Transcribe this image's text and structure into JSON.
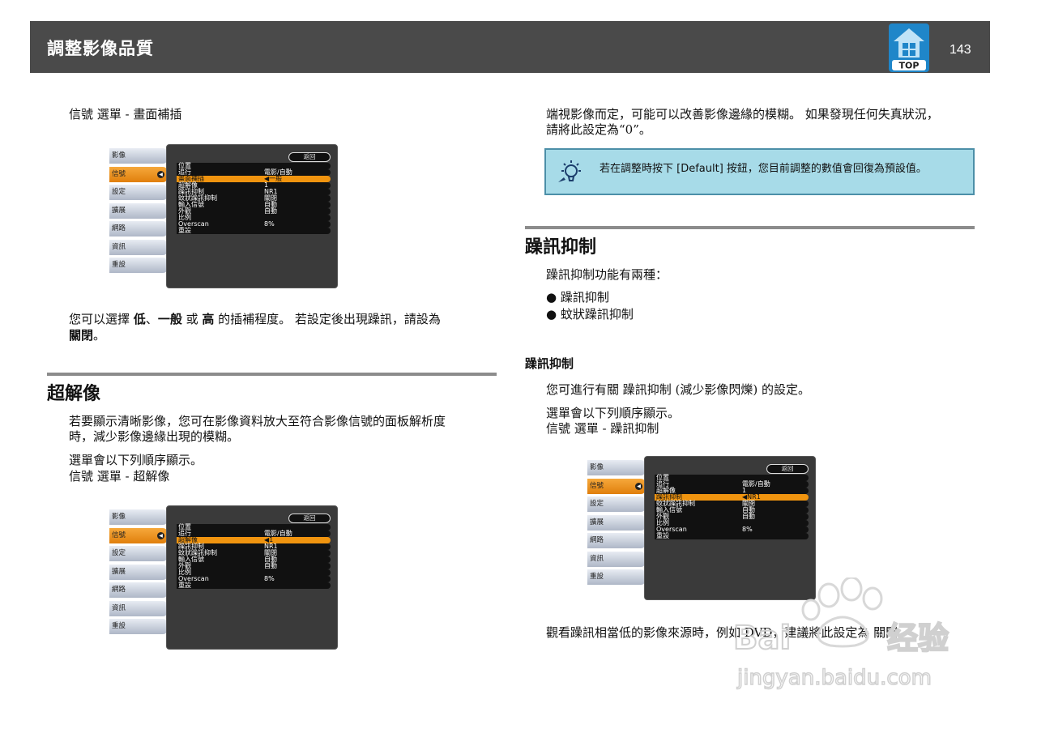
{
  "header": {
    "title": "調整影像品質",
    "page_number": "143",
    "top_label": "TOP"
  },
  "left": {
    "path1": "信號 選單 - 畫面補插",
    "para1_line1_parts": [
      "您可以選擇 ",
      "低",
      "、",
      "一般",
      " 或 ",
      "高",
      " 的插補程度。 若設定後出現躁訊，請設為"
    ],
    "para1_line2_bold": "關閉",
    "para1_line2_end": "。",
    "h_super": "超解像",
    "super_p1_l1": "若要顯示清晰影像，您可在影像資料放大至符合影像信號的面板解析度",
    "super_p1_l2": "時，減少影像邊緣出現的模糊。",
    "super_p2_l1": "選單會以下列順序顯示。",
    "super_p2_l2": "信號 選單 - 超解像"
  },
  "right": {
    "intro_l1": "端視影像而定，可能可以改善影像邊緣的模糊。 如果發現任何失真狀況，",
    "intro_l2": "請將此設定為“0”。",
    "tip": "若在調整時按下 [Default] 按鈕，您目前調整的數值會回復為預設值。",
    "h_noise": "躁訊抑制",
    "noise_intro": "躁訊抑制功能有兩種：",
    "bullets": [
      "躁訊抑制",
      "蚊狀躁訊抑制"
    ],
    "h2_noise": "躁訊抑制",
    "noise_p1": "您可進行有關 躁訊抑制 (減少影像閃爍) 的設定。",
    "noise_p2_l1": "選單會以下列順序顯示。",
    "noise_p2_l2": "信號 選單 - 躁訊抑制",
    "noise_end": "觀看躁訊相當低的影像來源時，例如 DVD，建議將此設定為 關閉。"
  },
  "menu_common": {
    "tabs": [
      "影像",
      "信號",
      "設定",
      "擴展",
      "網路",
      "資訊",
      "重設"
    ],
    "back": "返回"
  },
  "menu1": {
    "rows": [
      {
        "label": "位置",
        "value": ""
      },
      {
        "label": "追行",
        "value": "電影/自動"
      },
      {
        "label": "畫面補插",
        "value": "◀一般"
      },
      {
        "label": "超解像",
        "value": "1"
      },
      {
        "label": "躁訊抑制",
        "value": "NR1"
      },
      {
        "label": "蚊狀躁訊抑制",
        "value": "關閉"
      },
      {
        "label": "輸入信號",
        "value": "自動"
      },
      {
        "label": "外觀",
        "value": "自動"
      },
      {
        "label": "比例",
        "value": ""
      },
      {
        "label": "Overscan",
        "value": "8%"
      },
      {
        "label": "重設",
        "value": ""
      }
    ]
  },
  "menu2": {
    "rows": [
      {
        "label": "位置",
        "value": ""
      },
      {
        "label": "追行",
        "value": "電影/自動"
      },
      {
        "label": "超解像",
        "value": "◀1"
      },
      {
        "label": "躁訊抑制",
        "value": "NR1"
      },
      {
        "label": "蚊狀躁訊抑制",
        "value": "關閉"
      },
      {
        "label": "輸入信號",
        "value": "自動"
      },
      {
        "label": "外觀",
        "value": "自動"
      },
      {
        "label": "比例",
        "value": ""
      },
      {
        "label": "Overscan",
        "value": "8%"
      },
      {
        "label": "重設",
        "value": ""
      }
    ]
  },
  "menu3": {
    "rows": [
      {
        "label": "位置",
        "value": ""
      },
      {
        "label": "追行",
        "value": "電影/自動"
      },
      {
        "label": "超解像",
        "value": "1"
      },
      {
        "label": "躁訊抑制",
        "value": "◀NR1"
      },
      {
        "label": "蚊狀躁訊抑制",
        "value": "關閉"
      },
      {
        "label": "輸入信號",
        "value": "自動"
      },
      {
        "label": "外觀",
        "value": "自動"
      },
      {
        "label": "比例",
        "value": ""
      },
      {
        "label": "Overscan",
        "value": "8%"
      },
      {
        "label": "重設",
        "value": ""
      }
    ]
  },
  "watermark": {
    "brand": "Bai",
    "brand2": "经验",
    "url": "jingyan.baidu.com"
  }
}
